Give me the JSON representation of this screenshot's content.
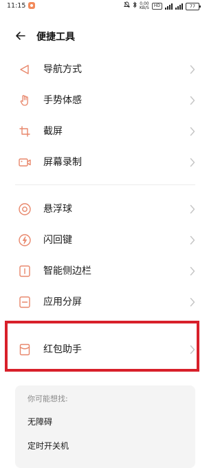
{
  "status_bar": {
    "time": "11:15",
    "net_speed_value": "0.00",
    "net_speed_unit": "KB/S",
    "hd_label": "HD",
    "battery": "77"
  },
  "header": {
    "title": "便捷工具"
  },
  "menu": {
    "group1": [
      {
        "label": "导航方式",
        "icon": "navigation-triangle-icon"
      },
      {
        "label": "手势体感",
        "icon": "hand-gesture-icon"
      },
      {
        "label": "截屏",
        "icon": "crop-screenshot-icon"
      },
      {
        "label": "屏幕录制",
        "icon": "video-record-icon"
      }
    ],
    "group2": [
      {
        "label": "悬浮球",
        "icon": "floating-ball-icon"
      },
      {
        "label": "闪回键",
        "icon": "flashback-icon"
      },
      {
        "label": "智能侧边栏",
        "icon": "smart-sidebar-icon"
      },
      {
        "label": "应用分屏",
        "icon": "split-screen-icon"
      }
    ],
    "group3": [
      {
        "label": "红包助手",
        "icon": "red-envelope-icon"
      }
    ]
  },
  "suggestions": {
    "title": "你可能想找:",
    "items": [
      "无障碍",
      "定时开关机"
    ]
  },
  "colors": {
    "accent": "#e8866a",
    "highlight": "#d8202a",
    "chevron": "#c4c4c4"
  }
}
